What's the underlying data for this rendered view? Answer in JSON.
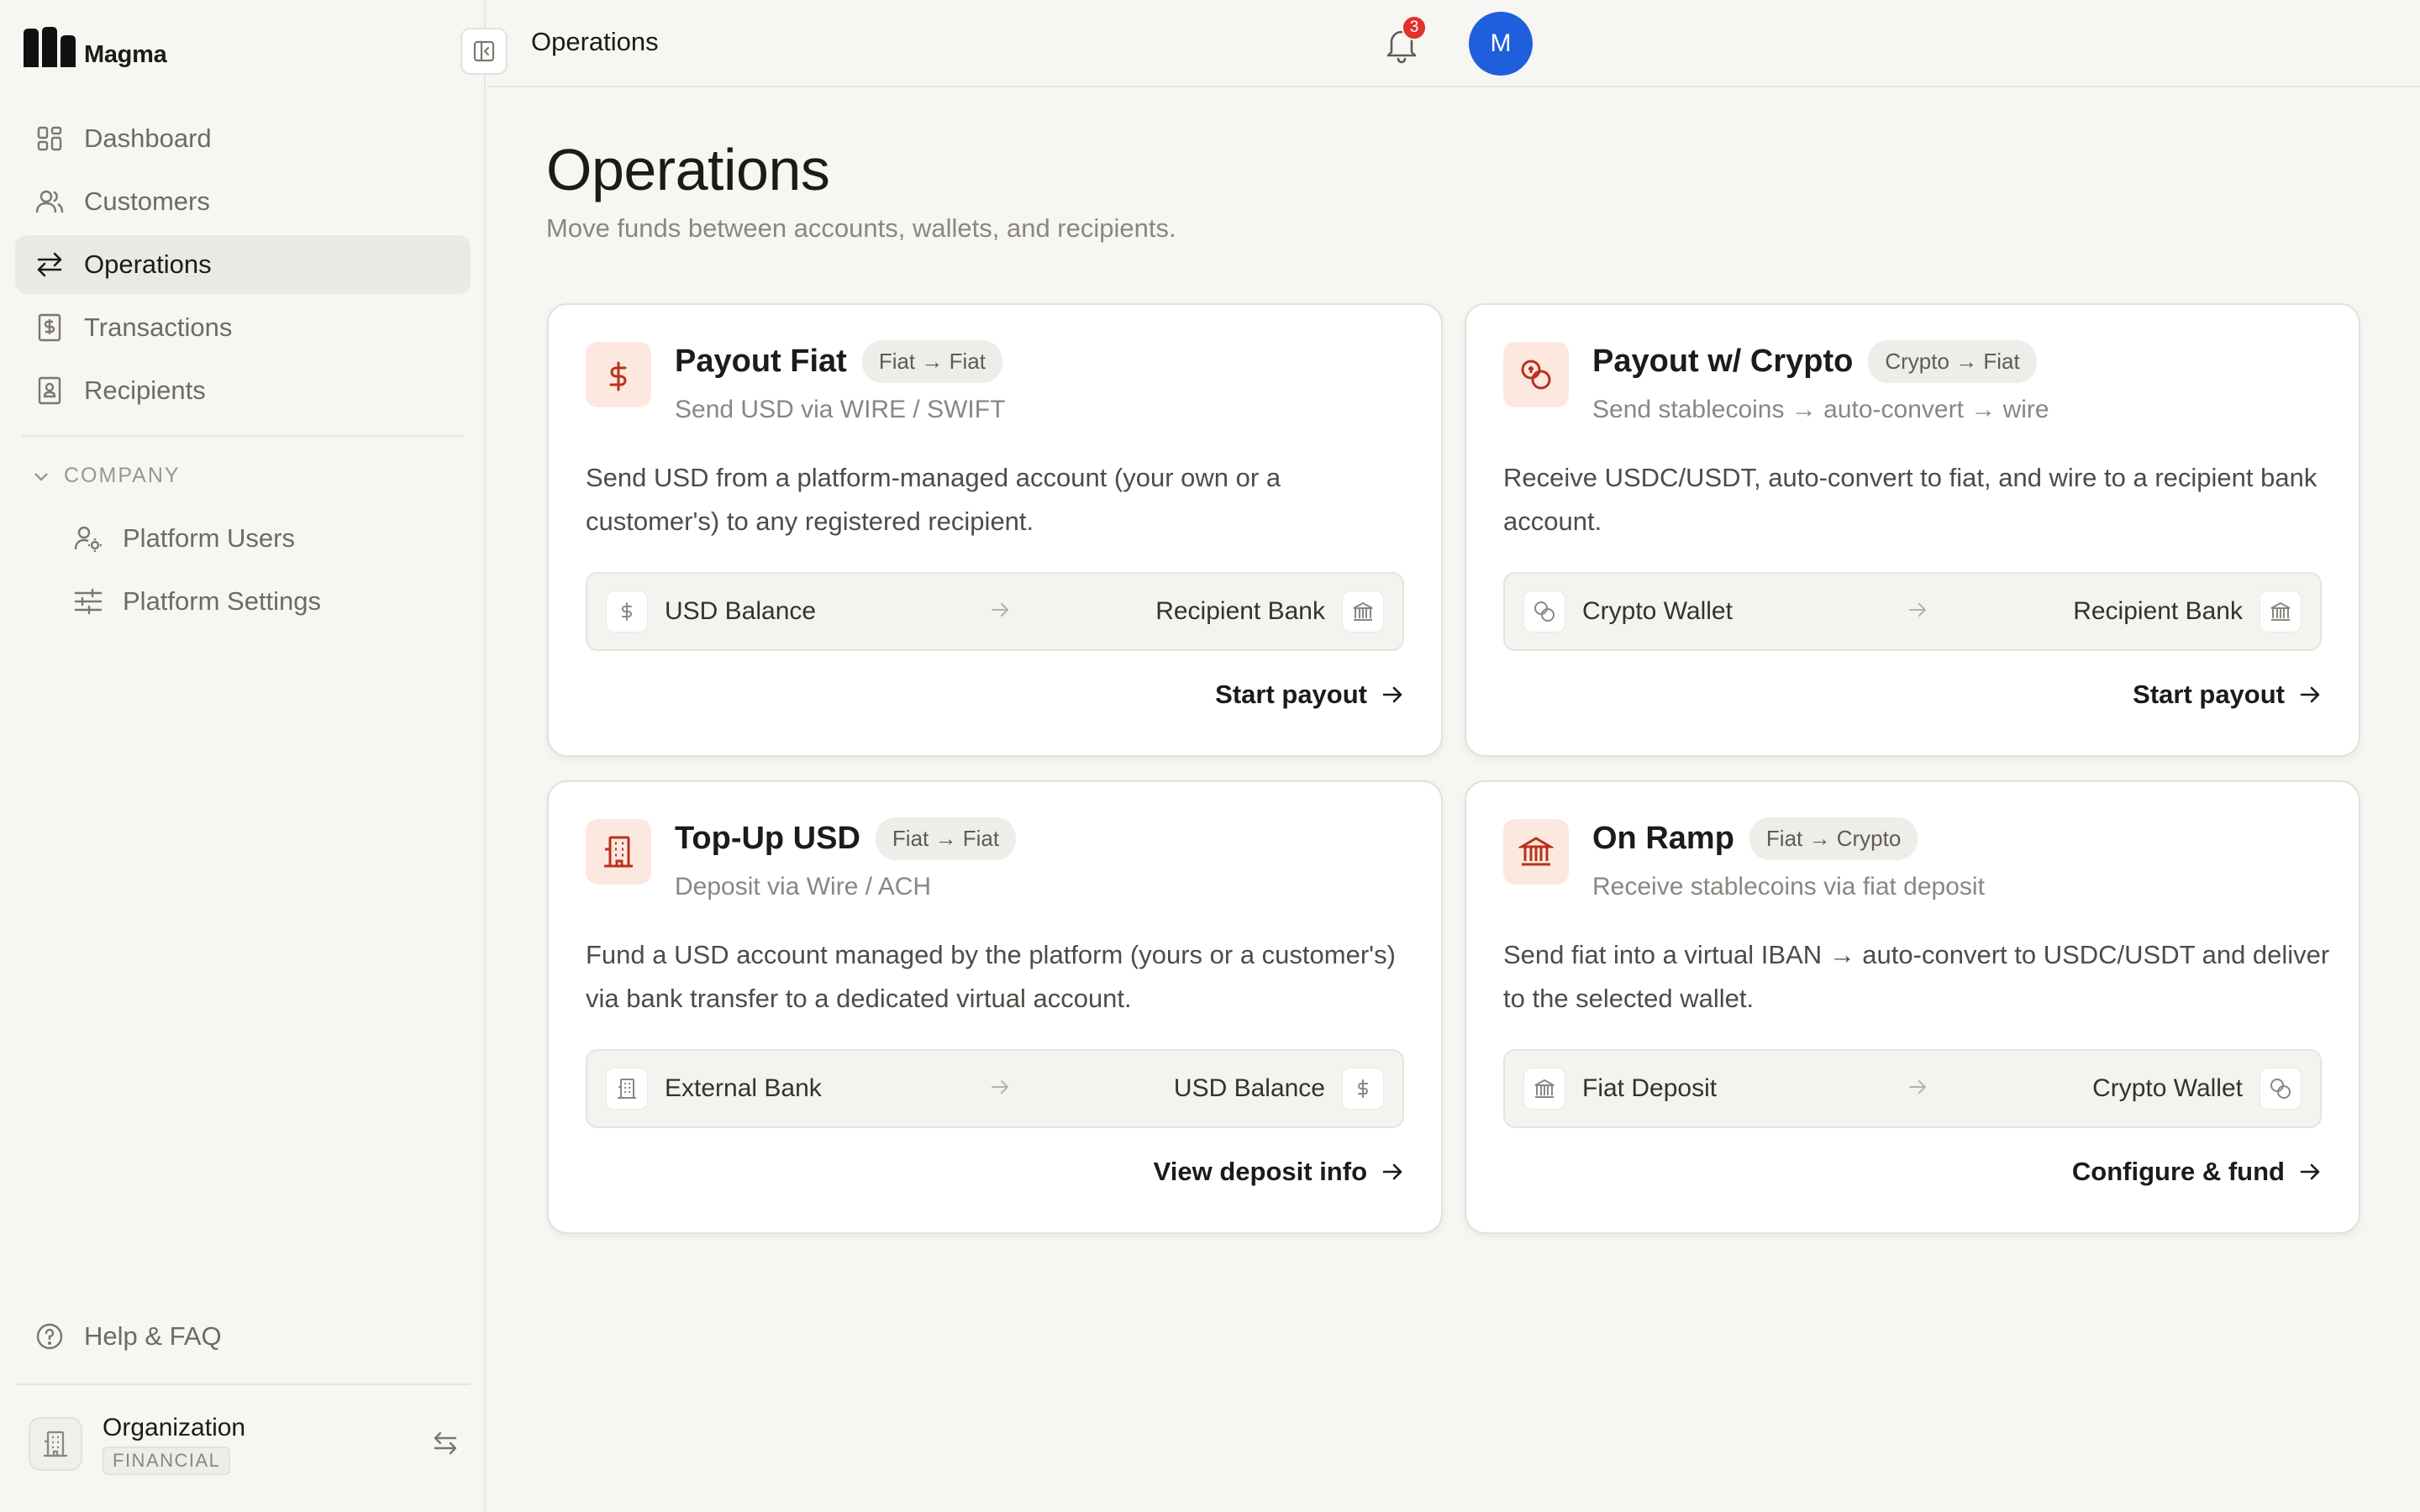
{
  "app": {
    "brand": "Magma"
  },
  "topbar": {
    "title": "Operations",
    "notification_count": "3",
    "avatar_initial": "M"
  },
  "sidebar": {
    "items": [
      {
        "label": "Dashboard",
        "icon": "grid-icon"
      },
      {
        "label": "Customers",
        "icon": "users-icon"
      },
      {
        "label": "Operations",
        "icon": "arrows-swap-icon",
        "active": true
      },
      {
        "label": "Transactions",
        "icon": "receipt-dollar-icon"
      },
      {
        "label": "Recipients",
        "icon": "contact-book-icon"
      }
    ],
    "section": {
      "label": "COMPANY",
      "items": [
        {
          "label": "Platform Users",
          "icon": "user-cog-icon"
        },
        {
          "label": "Platform Settings",
          "icon": "sliders-icon"
        }
      ]
    },
    "help_label": "Help & FAQ",
    "org": {
      "name": "Organization",
      "badge": "FINANCIAL"
    }
  },
  "page": {
    "title": "Operations",
    "subtitle": "Move funds between accounts, wallets, and recipients."
  },
  "cards": [
    {
      "title": "Payout Fiat",
      "tag": "Fiat → Fiat",
      "subtitle": "Send USD via WIRE / SWIFT",
      "description": "Send USD from a platform-managed account (your own or a customer's) to any registered recipient.",
      "from": "USD Balance",
      "to": "Recipient Bank",
      "action": "Start payout",
      "icon": "dollar-icon"
    },
    {
      "title": "Payout w/ Crypto",
      "tag": "Crypto → Fiat",
      "subtitle": "Send stablecoins → auto-convert → wire",
      "description": "Receive USDC/USDT, auto-convert to fiat, and wire to a recipient bank account.",
      "from": "Crypto Wallet",
      "to": "Recipient Bank",
      "action": "Start payout",
      "icon": "coins-icon"
    },
    {
      "title": "Top-Up USD",
      "tag": "Fiat → Fiat",
      "subtitle": "Deposit via Wire / ACH",
      "description": "Fund a USD account managed by the platform (yours or a customer's) via bank transfer to a dedicated virtual account.",
      "from": "External Bank",
      "to": "USD Balance",
      "action": "View deposit info",
      "icon": "building-icon"
    },
    {
      "title": "On Ramp",
      "tag": "Fiat → Crypto",
      "subtitle": "Receive stablecoins via fiat deposit",
      "description": "Send fiat into a virtual IBAN → auto-convert to USDC/USDT and deliver to the selected wallet.",
      "from": "Fiat Deposit",
      "to": "Crypto Wallet",
      "action": "Configure & fund",
      "icon": "bank-icon"
    }
  ],
  "colors": {
    "accent_bg": "#fde8df",
    "accent_icon": "#b8321e",
    "avatar": "#1f5fde",
    "badge": "#e0332c"
  }
}
